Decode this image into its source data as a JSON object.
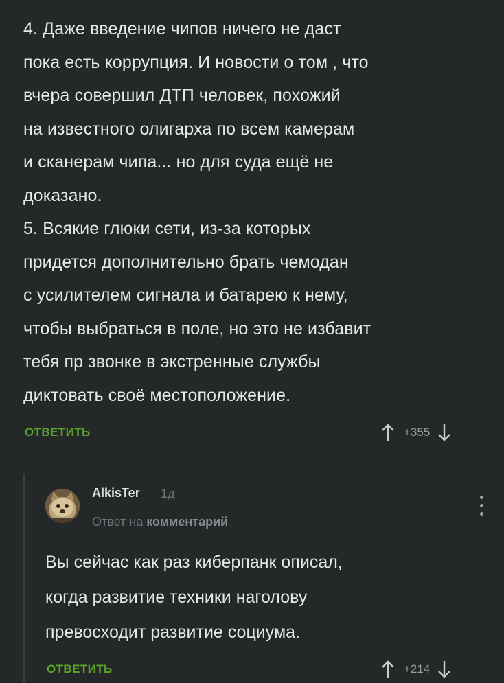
{
  "parent_comment": {
    "lines": [
      "4. Даже введение чипов ничего не даст",
      "пока есть коррупция. И новости о том , что",
      "вчера совершил ДТП человек, похожий",
      "на известного олигарха по всем камерам",
      "и сканерам чипа... но для суда ещё не",
      "доказано.",
      "5. Всякие глюки сети, из-за которых",
      "придется дополнительно брать чемодан",
      "с усилителем сигнала и батарею к нему,",
      "чтобы выбраться в поле, но это не избавит",
      "тебя пр звонке в экстренные службы",
      "диктовать своё местоположение."
    ],
    "reply_label": "ОТВЕТИТЬ",
    "score": "+355"
  },
  "reply_comment": {
    "author": "AlkisTer",
    "time": "1д",
    "reply_to_prefix": "Ответ на",
    "reply_to_link": "комментарий",
    "lines": [
      "Вы сейчас как раз киберпанк описал,",
      "когда развитие техники наголову",
      "превосходит развитие социума."
    ],
    "reply_label": "ОТВЕТИТЬ",
    "score": "+214"
  },
  "icons": {
    "upvote": "arrow-up-icon",
    "downvote": "arrow-down-icon",
    "more": "more-vertical-icon"
  },
  "colors": {
    "background": "#242829",
    "accent": "#5aa428",
    "text": "#e6e8e8",
    "muted": "#6f7577"
  }
}
